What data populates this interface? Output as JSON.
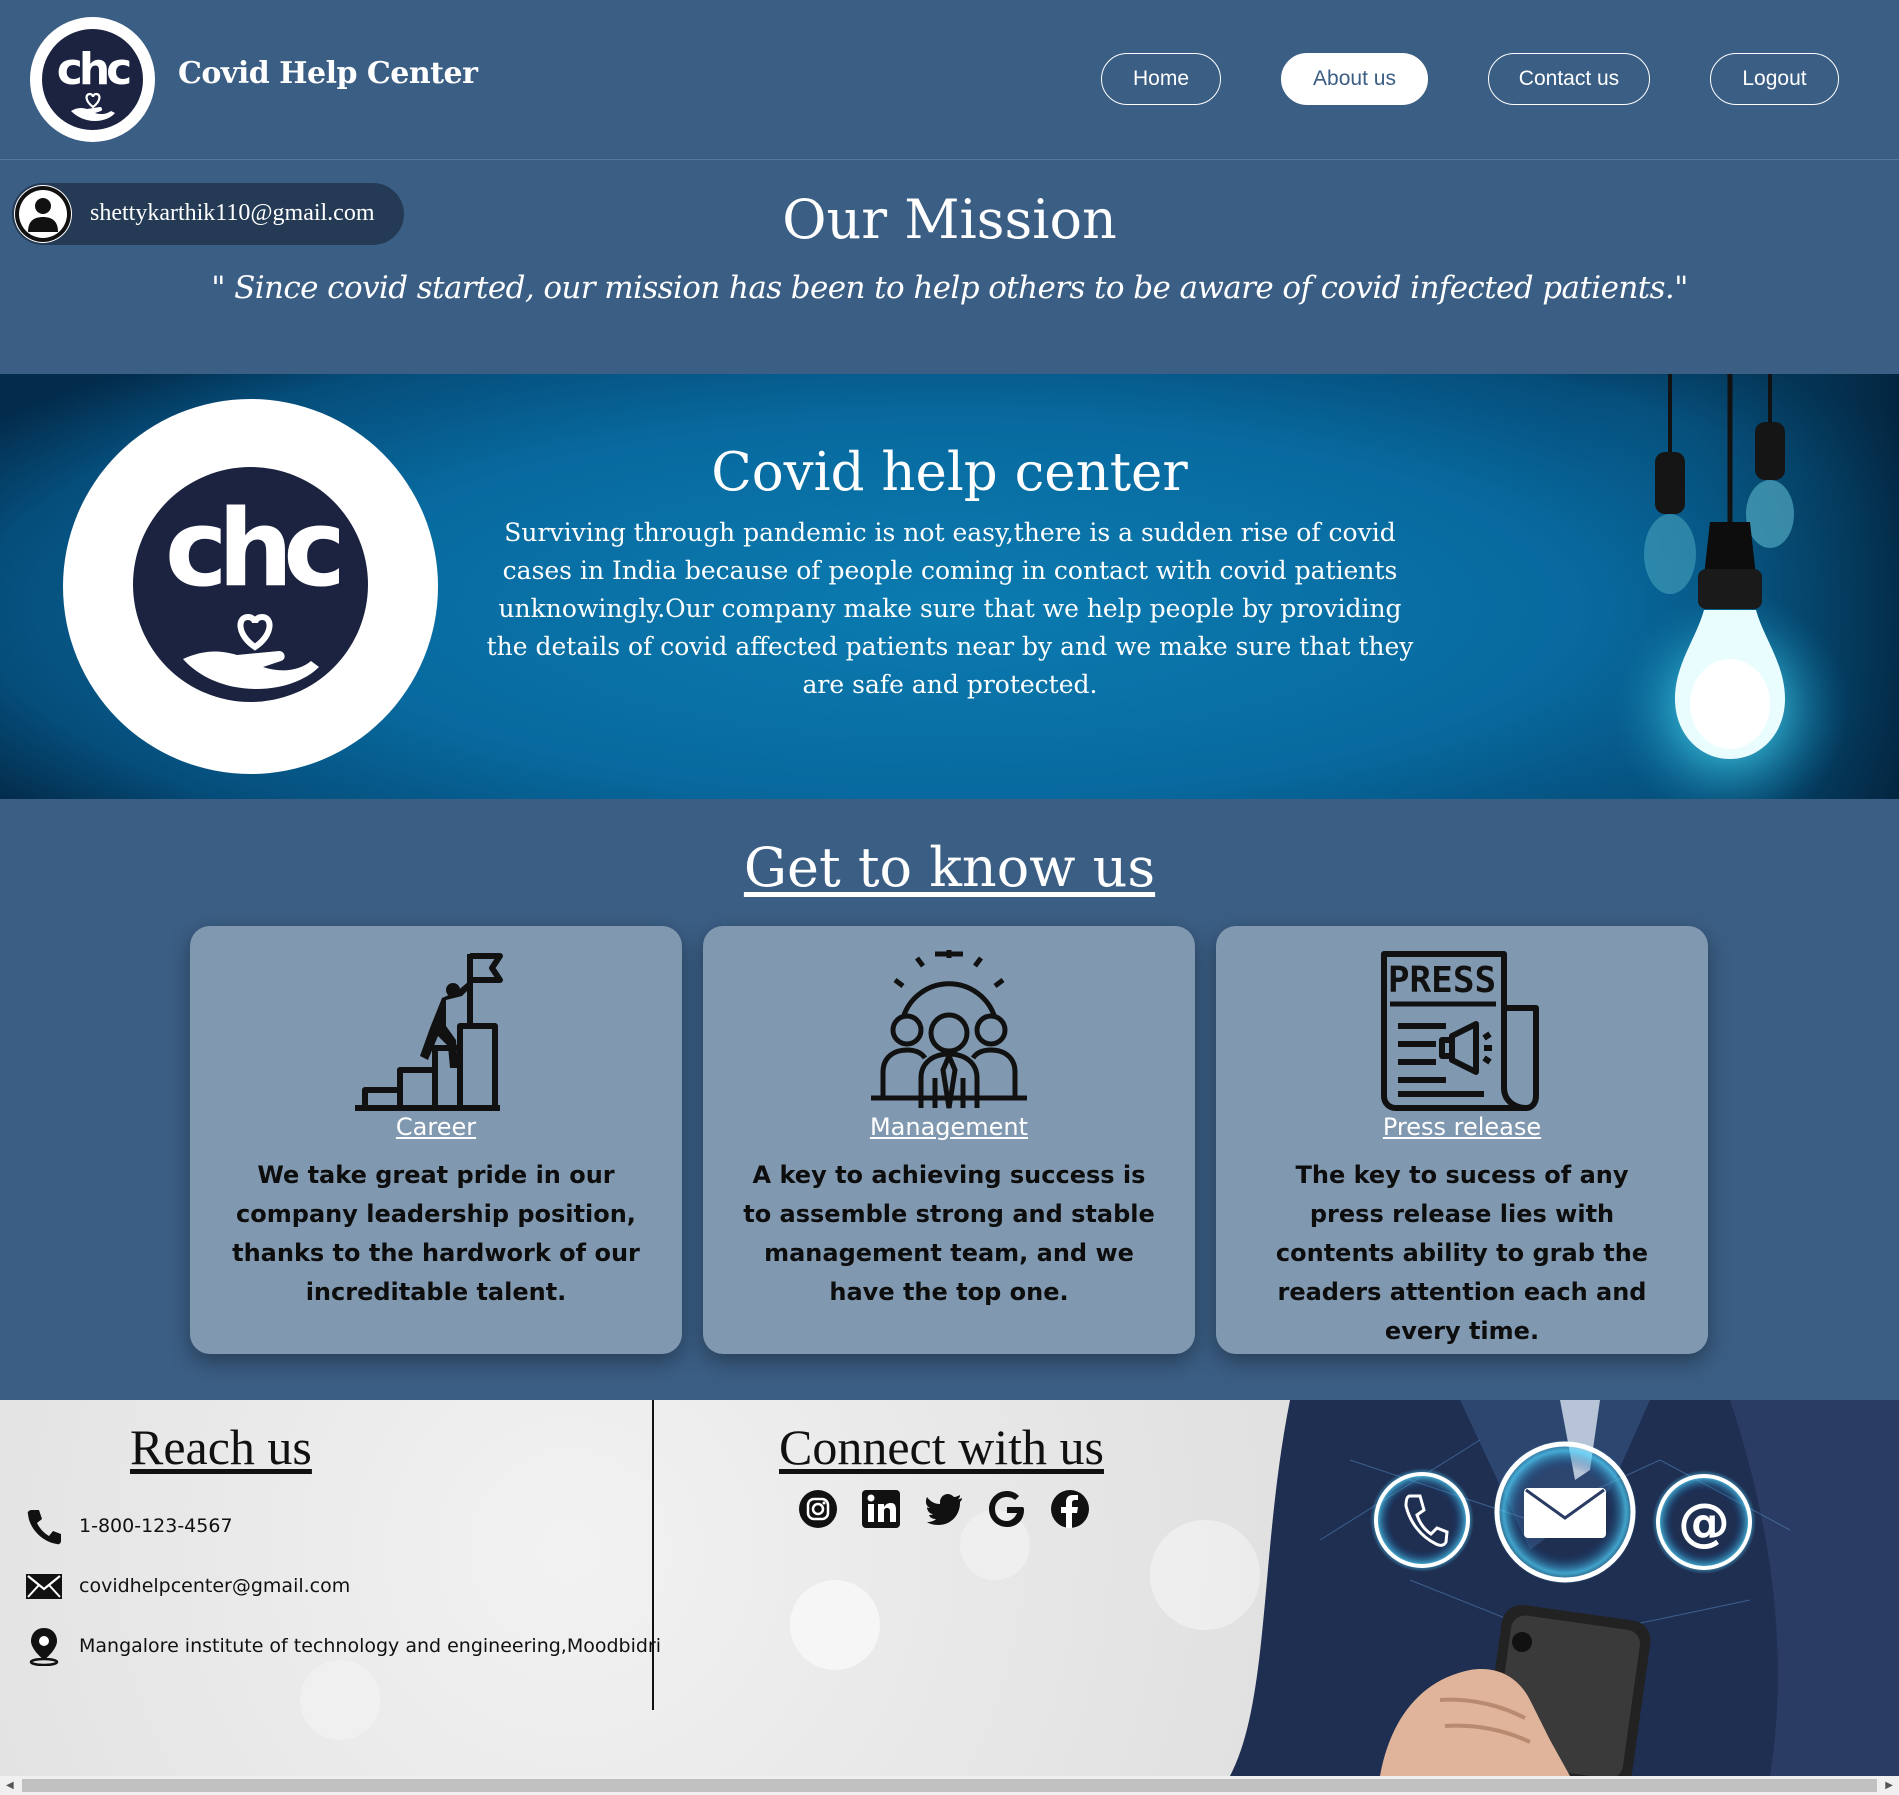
{
  "header": {
    "logo_text": "chc",
    "brand": "Covid Help Center",
    "nav": [
      {
        "label": "Home",
        "active": false
      },
      {
        "label": "About us",
        "active": true
      },
      {
        "label": "Contact us",
        "active": false
      },
      {
        "label": "Logout",
        "active": false
      }
    ]
  },
  "user": {
    "email": "shettykarthik110@gmail.com",
    "icon": "user-avatar-icon"
  },
  "mission": {
    "title": "Our Mission",
    "quote": "\" Since covid started, our mission has been to help others to be aware of covid infected patients.\""
  },
  "banner": {
    "logo_text": "chc",
    "title": "Covid help center",
    "text": "Surviving through pandemic is not easy,there is a sudden rise of covid cases in India because of people coming in contact with covid patients unknowingly.Our company make sure that we help people by providing the details of covid affected patients near by and we make sure that they are safe and protected."
  },
  "know_us": {
    "title": "Get to know us",
    "cards": [
      {
        "link": "Career",
        "icon": "career-ladder-icon",
        "text": "We take great pride in our company leadership position, thanks to the hardwork of our increditable talent."
      },
      {
        "link": "Management",
        "icon": "management-team-icon",
        "text": "A key to achieving success is to assemble strong and stable management team, and we have the top one."
      },
      {
        "link": "Press release",
        "icon": "press-release-icon",
        "text": "The key to sucess of any press release lies with contents ability to grab the readers attention each and every time."
      }
    ]
  },
  "reach": {
    "title": "Reach us",
    "phone": "1-800-123-4567",
    "email": "covidhelpcenter@gmail.com",
    "address": "Mangalore institute of technology and engineering,Moodbidri"
  },
  "connect": {
    "title": "Connect with us",
    "socials": [
      "instagram-icon",
      "linkedin-icon",
      "twitter-icon",
      "google-icon",
      "facebook-icon"
    ]
  },
  "colors": {
    "page_bg": "#3b5e84",
    "banner_bg": "#086a9f",
    "card_bg": "#8199b0",
    "logo_dark": "#1b2340"
  }
}
